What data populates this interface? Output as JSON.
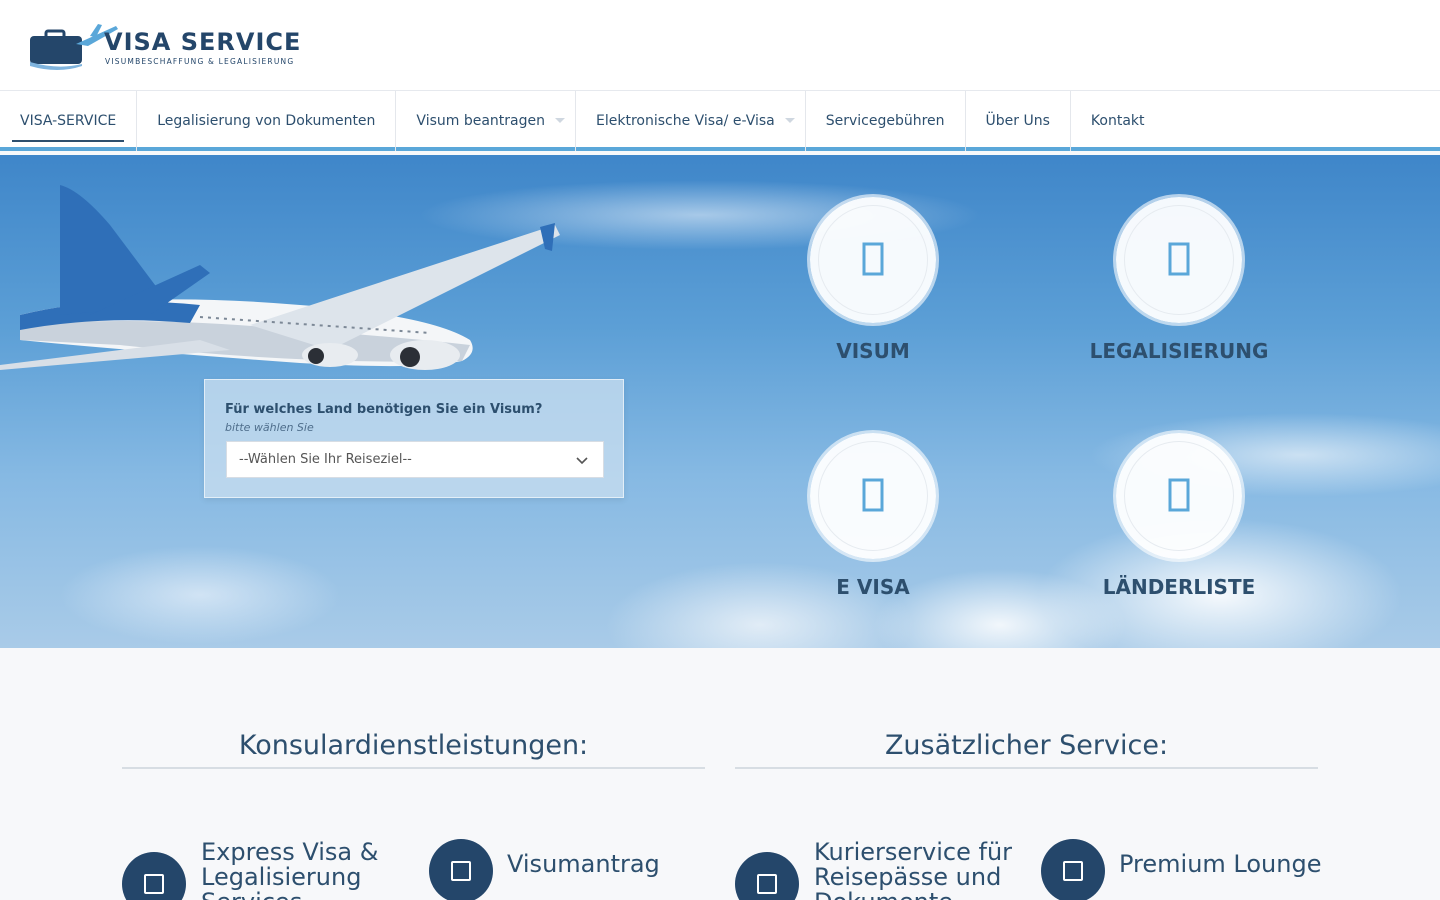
{
  "brand": {
    "title": "VISA SERVICE",
    "subtitle": "VISUMBESCHAFFUNG & LEGALISIERUNG"
  },
  "nav": {
    "items": [
      {
        "label": "VISA-SERVICE",
        "active": true,
        "has_submenu": false
      },
      {
        "label": "Legalisierung von Dokumenten",
        "active": false,
        "has_submenu": false
      },
      {
        "label": "Visum beantragen",
        "active": false,
        "has_submenu": true
      },
      {
        "label": "Elektronische Visa/ e-Visa",
        "active": false,
        "has_submenu": true
      },
      {
        "label": "Servicegebühren",
        "active": false,
        "has_submenu": false
      },
      {
        "label": "Über Uns",
        "active": false,
        "has_submenu": false
      },
      {
        "label": "Kontakt",
        "active": false,
        "has_submenu": false
      }
    ]
  },
  "search": {
    "question": "Für welches Land benötigen Sie ein Visum?",
    "hint": "bitte wählen Sie",
    "selected": "--Wählen Sie Ihr Reiseziel--"
  },
  "tiles": [
    {
      "label": "VISUM",
      "icon": "passport-icon"
    },
    {
      "label": "LEGALISIERUNG",
      "icon": "document-icon"
    },
    {
      "label": "E VISA",
      "icon": "laptop-icon"
    },
    {
      "label": "LÄNDERLISTE",
      "icon": "globe-icon"
    }
  ],
  "sections": {
    "consular": {
      "title": "Konsulardienstleistungen:",
      "features": [
        {
          "lines": [
            "Express Visa &",
            "Legalisierung",
            "Services"
          ]
        },
        {
          "lines": [
            "Visumantrag"
          ]
        }
      ]
    },
    "additional": {
      "title": "Zusätzlicher Service:",
      "features": [
        {
          "lines": [
            "Kurierservice für",
            "Reisepässe und",
            "Dokumente"
          ]
        },
        {
          "lines": [
            "Premium Lounge"
          ]
        }
      ]
    }
  },
  "colors": {
    "brand_dark": "#24466a",
    "nav_accent": "#5aa7d9",
    "sky": "#5c9fd6",
    "tile_icon": "#5aa7d9"
  }
}
